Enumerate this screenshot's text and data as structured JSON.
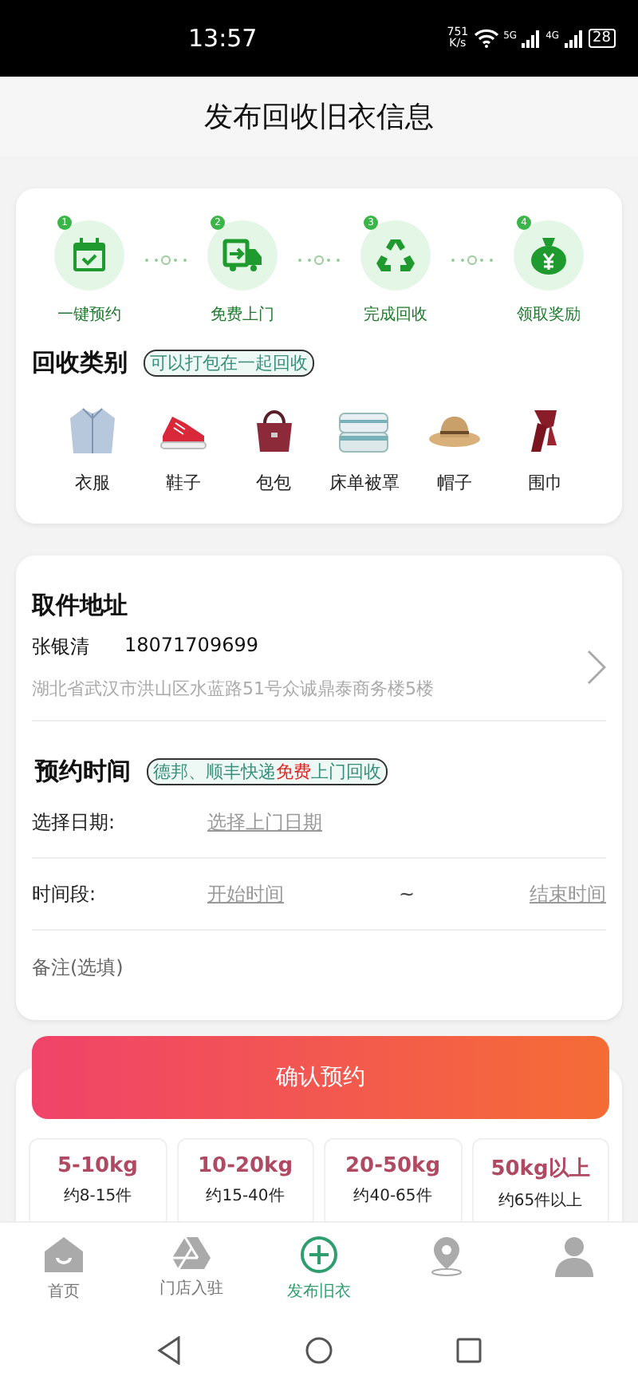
{
  "status_bar": {
    "time": "13:57",
    "speed": "751\nK/s",
    "net1": "5G",
    "net2": "4G",
    "battery": "28"
  },
  "header": {
    "title": "发布回收旧衣信息"
  },
  "steps": [
    {
      "number": "1",
      "label": "一键预约",
      "kind": "calendar"
    },
    {
      "number": "2",
      "label": "免费上门",
      "kind": "truck"
    },
    {
      "number": "3",
      "label": "完成回收",
      "kind": "recycle"
    },
    {
      "number": "4",
      "label": "领取奖励",
      "kind": "money"
    }
  ],
  "categories": {
    "title": "回收类别",
    "tag": "可以打包在一起回收",
    "items": [
      {
        "label": "衣服",
        "kind": "jacket"
      },
      {
        "label": "鞋子",
        "kind": "sneaker"
      },
      {
        "label": "包包",
        "kind": "handbag"
      },
      {
        "label": "床单被罩",
        "kind": "blanket"
      },
      {
        "label": "帽子",
        "kind": "hat"
      },
      {
        "label": "围巾",
        "kind": "scarf"
      }
    ]
  },
  "address": {
    "title": "取件地址",
    "name": "张银清",
    "phone": "18071709699",
    "detail": "湖北省武汉市洪山区水蓝路51号众诚鼎泰商务楼5楼"
  },
  "appointment": {
    "title": "预约时间",
    "tag": "德邦、顺丰快递**免费**上门回收",
    "date_label": "选择日期:",
    "date_placeholder": "选择上门日期",
    "time_label": "时间段:",
    "start_placeholder": "开始时间",
    "separator": "~",
    "end_placeholder": "结束时间",
    "note_placeholder": "备注(选填)"
  },
  "confirm_button": "确认预约",
  "weights": [
    {
      "range": "5-10kg",
      "count": "约8-15件"
    },
    {
      "range": "10-20kg",
      "count": "约15-40件"
    },
    {
      "range": "20-50kg",
      "count": "约40-65件"
    },
    {
      "range": "50kg以上",
      "count": "约65件以上"
    }
  ],
  "tab_bar": [
    {
      "label": "首页",
      "kind": "home",
      "selected": false
    },
    {
      "label": "门店入驻",
      "kind": "triangle",
      "selected": false
    },
    {
      "label": "发布旧衣",
      "kind": "plus",
      "selected": true
    },
    {
      "kind": "pin",
      "selected": false
    },
    {
      "kind": "person",
      "selected": false
    }
  ]
}
